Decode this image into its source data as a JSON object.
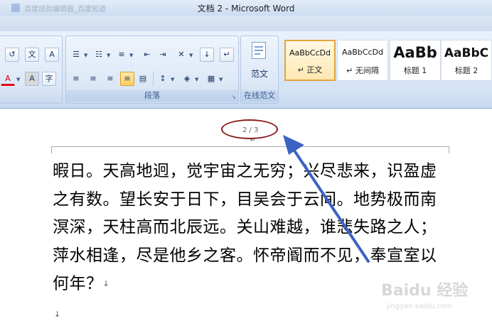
{
  "window": {
    "title": "文档 2 - Microsoft Word",
    "background_tab_text": "百度经验编辑器_百度知道"
  },
  "ribbon": {
    "groups": [
      {
        "label": "段落"
      },
      {
        "label": "在线范文"
      }
    ],
    "online_template_button": "范文",
    "font_group": {
      "phonetic_btn": "文",
      "char_border_btn": "A",
      "shade_btn": "A",
      "enclose_btn": "字",
      "font_color_btn": "A"
    },
    "styles": [
      {
        "sample": "AaBbCcDd",
        "name": "↵ 正文",
        "selected": true
      },
      {
        "sample": "AaBbCcDd",
        "name": "↵ 无间隔",
        "selected": false
      },
      {
        "sample": "AaBb",
        "name": "标题 1",
        "selected": false
      },
      {
        "sample": "AaBbC",
        "name": "标题 2",
        "selected": false
      }
    ]
  },
  "document": {
    "page_indicator": "2 / 3",
    "page_indicator_mark": "↵",
    "lines": [
      "暇日。天高地迥，觉宇宙之无穷；兴尽悲来，识盈虚",
      "之有数。望长安于日下，目吴会于云间。地势极而南",
      "溟深，天柱高而北辰远。关山难越，谁悲失路之人；",
      "萍水相逢，尽是他乡之客。怀帝阍而不见，奉宣室以",
      "何年？"
    ],
    "paragraph_mark": "↓",
    "empty_paragraph_mark": "↓"
  },
  "annotation": {
    "oval_color": "#8c1d1d",
    "arrow_color": "#3b63c4"
  },
  "watermark": {
    "brand": "Baidu 经验",
    "url": "jingyan.baidu.com"
  }
}
